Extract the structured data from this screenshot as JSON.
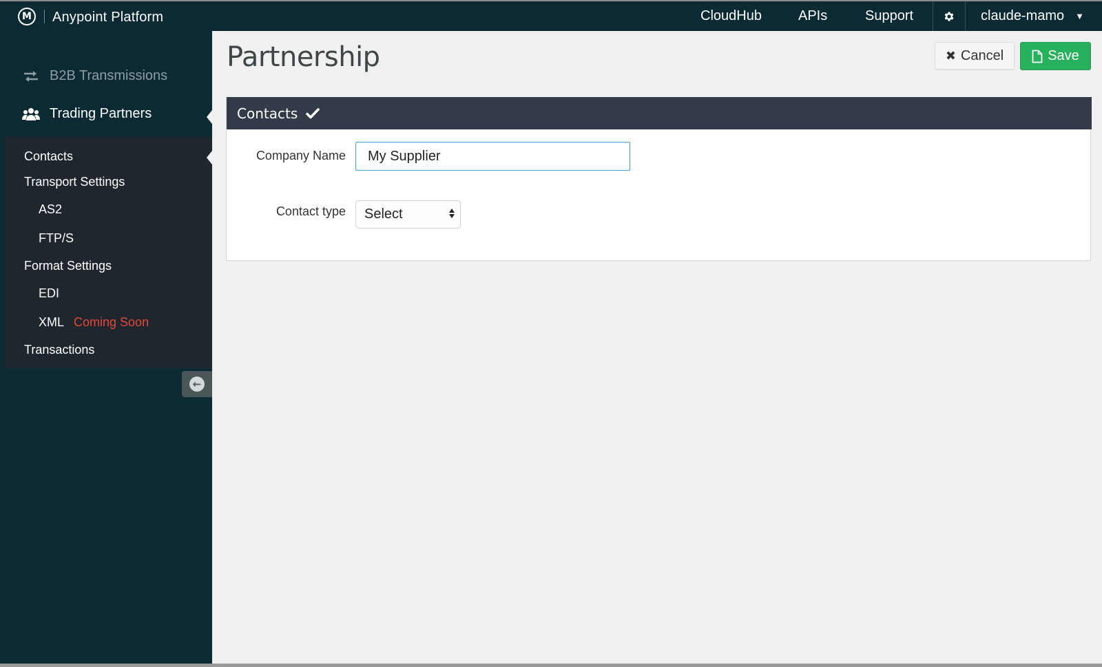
{
  "header": {
    "brand": "Anypoint Platform",
    "nav": [
      "CloudHub",
      "APIs",
      "Support"
    ],
    "user": "claude-mamo",
    "logo_letter": "M"
  },
  "sidebar": {
    "b2b_label": "B2B Transmissions",
    "trading_partners_label": "Trading Partners",
    "sub": {
      "contacts": "Contacts",
      "transport": "Transport Settings",
      "as2": "AS2",
      "ftps": "FTP/S",
      "format": "Format Settings",
      "edi": "EDI",
      "xml": "XML",
      "coming_soon": "Coming Soon",
      "transactions": "Transactions"
    }
  },
  "main": {
    "title": "Partnership",
    "cancel_label": "Cancel",
    "save_label": "Save",
    "panel_title": "Contacts",
    "company_label": "Company Name",
    "company_value": "My Supplier",
    "contact_type_label": "Contact type",
    "contact_type_value": "Select"
  },
  "colors": {
    "topbar": "#0b2a33",
    "subpanel": "#1f262d",
    "panel_header": "#343b48",
    "save": "#27b15d",
    "coming_soon": "#e5473a",
    "focus": "#3aa0d8"
  }
}
